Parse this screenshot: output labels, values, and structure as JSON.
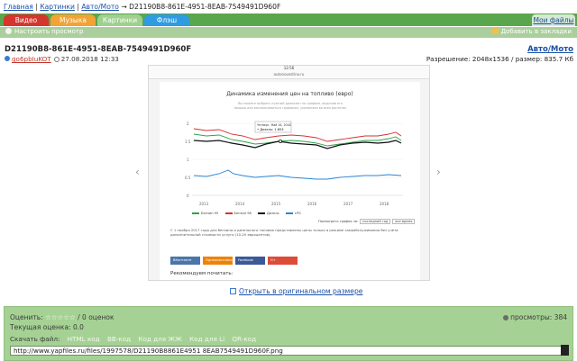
{
  "breadcrumb": {
    "home": "Главная",
    "images": "Картинки",
    "auto": "Авто/Мото",
    "arrow": "→",
    "current": "D21190B8-861E-4951-8EAB-7549491D960F"
  },
  "tabs": [
    {
      "label": "Видео",
      "color": "#d4362e"
    },
    {
      "label": "Музыка",
      "color": "#f1a334"
    },
    {
      "label": "Картинки",
      "color": "#9fd08e"
    },
    {
      "label": "Флэш",
      "color": "#2f9be0"
    }
  ],
  "my_files": "Мои файлы",
  "toolbar": {
    "setup_view": "Настроить просмотр",
    "add_bookmark": "Добавить в закладки"
  },
  "file": {
    "title": "D21190B8-861E-4951-8EAB-7549491D960F",
    "category": "Авто/Мото",
    "user": "go6pbIuKOT",
    "date": "27.08.2018 12:33",
    "resolution": "Разрешение: 2048x1536 / размер: 835.7 Кб"
  },
  "preview": {
    "time": "12:56",
    "url": "autonovostino.ru",
    "chart_title": "Динамика изменения цен на топливо (евро)",
    "chart_sub": "Вы можете выбрать нужный диапазон на графике, выделив его мышью или воспользоваться графиком, указанным во всех расчетах",
    "tooltip_date": "Четверг, Май 16, 2018",
    "tooltip_value": "• Дизель: 1.653",
    "years": [
      "2013",
      "2014",
      "2015",
      "2016",
      "2017",
      "2018"
    ],
    "y_ticks": [
      "2",
      "1.5",
      "1",
      "0.5",
      "0"
    ],
    "legend": [
      {
        "label": "Бензин 95",
        "color": "#2aa44a"
      },
      {
        "label": "Бензин 98",
        "color": "#d63030"
      },
      {
        "label": "Дизель",
        "color": "#111111"
      },
      {
        "label": "LPG",
        "color": "#2a86d4"
      }
    ],
    "pick_label": "Посмотреть график за:",
    "pick_a": "последний год",
    "pick_b": "все время",
    "paragraph": "С 1 ноября 2017 года для бензина и дизельного топлива представлены цены только в режиме самообслуживания без учёта дополнительной стоимости услуги (10-20 евроцентов).",
    "share": [
      {
        "label": "ВКонтакте",
        "color": "#4a76a8"
      },
      {
        "label": "Одноклассники",
        "color": "#ee8208"
      },
      {
        "label": "Facebook",
        "color": "#3b5998"
      },
      {
        "label": "G+",
        "color": "#dd4b39"
      }
    ],
    "recommend": "Рекомендуем почитать:"
  },
  "open_original": "Открыть в оригинальном размере",
  "panel": {
    "rate_label": "Оценить:",
    "stars": "☆☆☆☆☆",
    "votes": "/ 0 оценок",
    "views": "просмотры: 384",
    "current_rating": "Текущая оценка: 0.0",
    "download_label": "Скачать файл:",
    "links": [
      "HTML код",
      "BB-код",
      "Код для ЖЖ",
      "Код для Li",
      "QR-код"
    ],
    "file_url": "http://www.yapfiles.ru/files/1997578/D21190B8861E4951 8EAB7549491D960F.png"
  }
}
